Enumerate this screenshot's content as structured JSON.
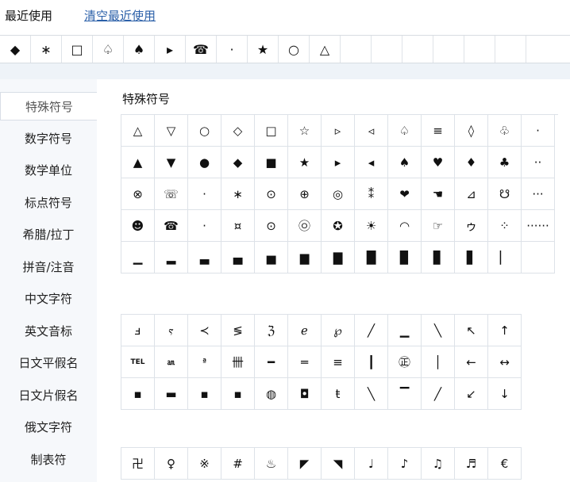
{
  "recent": {
    "title": "最近使用",
    "clear_label": "清空最近使用",
    "symbols": [
      "◆",
      "∗",
      "□",
      "♤",
      "♠",
      "▸",
      "☎",
      "·",
      "★",
      "○",
      "△",
      "",
      "",
      "",
      "",
      "",
      "",
      ""
    ]
  },
  "sidebar": {
    "items": [
      {
        "label": "特殊符号"
      },
      {
        "label": "数字符号"
      },
      {
        "label": "数学单位"
      },
      {
        "label": "标点符号"
      },
      {
        "label": "希腊/拉丁"
      },
      {
        "label": "拼音/注音"
      },
      {
        "label": "中文字符"
      },
      {
        "label": "英文音标"
      },
      {
        "label": "日文平假名"
      },
      {
        "label": "日文片假名"
      },
      {
        "label": "俄文字符"
      },
      {
        "label": "制表符"
      }
    ],
    "active_index": 0
  },
  "main": {
    "section_title": "特殊符号",
    "groups": [
      {
        "rows": [
          [
            "△",
            "▽",
            "○",
            "◇",
            "□",
            "☆",
            "▹",
            "◃",
            "♤",
            "≡",
            "◊",
            "♧",
            "·"
          ],
          [
            "▲",
            "▼",
            "●",
            "◆",
            "■",
            "★",
            "▸",
            "◂",
            "♠",
            "♥",
            "♦",
            "♣",
            "··"
          ],
          [
            "⊗",
            "☏",
            "·",
            "∗",
            "⊙",
            "⊕",
            "◎",
            "⁑",
            "❤",
            "☚",
            "⊿",
            "☋",
            "···"
          ],
          [
            "☻",
            "☎",
            "·",
            "¤",
            "⊙",
            "㉧",
            "✪",
            "☀",
            "◠",
            "☞",
            "ゥ",
            "⁘",
            "······"
          ],
          [
            "▁",
            "▂",
            "▃",
            "▄",
            "▅",
            "▆",
            "▇",
            "█",
            "▉",
            "▊",
            "▋",
            "▏",
            ""
          ]
        ]
      },
      {
        "rows": [
          [
            "ⅎ",
            "ⲋ",
            "≺",
            "≶",
            "ℨ",
            "ℯ",
            "℘",
            "╱",
            "▁",
            "╲",
            "↖",
            "↑",
            "↗"
          ],
          [
            "TEL",
            "㏂",
            "ª",
            "卌",
            "━",
            "═",
            "≡",
            "┃",
            "㊣",
            "│",
            "←",
            "↔",
            "→"
          ],
          [
            "▪",
            "▬",
            "▪",
            "▪",
            "◍",
            "◘",
            "ŧ",
            "╲",
            "▔",
            "╱",
            "↙",
            "↓",
            "↘"
          ]
        ]
      },
      {
        "rows": [
          [
            "卍",
            "♀",
            "※",
            "#",
            "♨",
            "◤",
            "◥",
            "♩",
            "♪",
            "♫",
            "♬",
            "€",
            "§"
          ]
        ]
      }
    ]
  }
}
